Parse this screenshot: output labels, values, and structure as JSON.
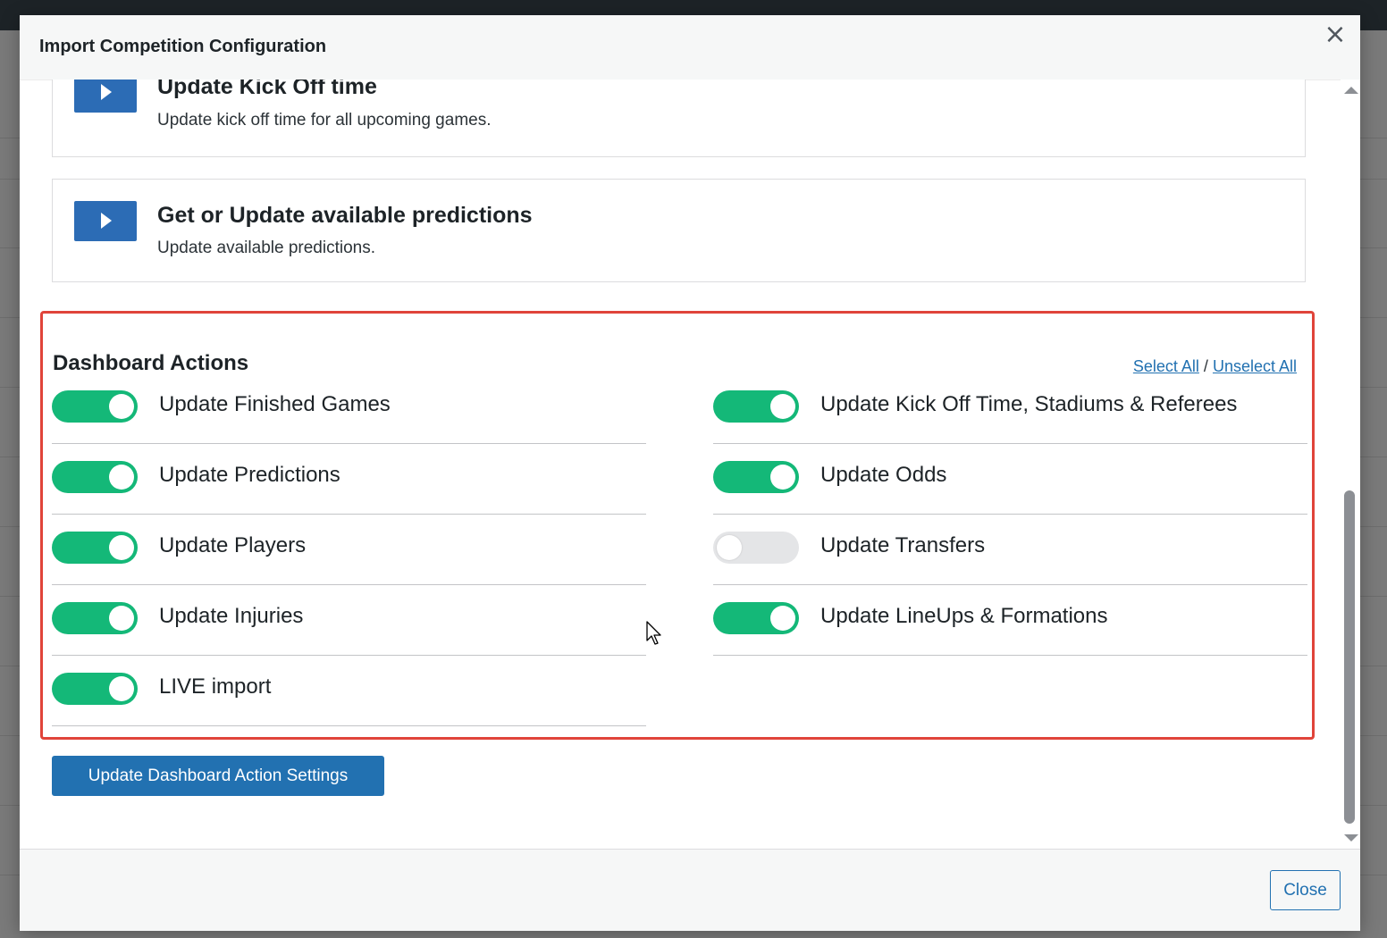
{
  "modal": {
    "title": "Import Competition Configuration",
    "close_icon": "×"
  },
  "actions": [
    {
      "title": "Update Kick Off time",
      "description": "Update kick off time for all upcoming games."
    },
    {
      "title": "Get or Update available predictions",
      "description": "Update available predictions."
    }
  ],
  "dashboard": {
    "title": "Dashboard Actions",
    "select_all": "Select All",
    "separator": "/",
    "unselect_all": "Unselect All",
    "toggles": [
      {
        "label": "Update Finished Games",
        "on": true
      },
      {
        "label": "Update Kick Off Time, Stadiums & Referees",
        "on": true
      },
      {
        "label": "Update Predictions",
        "on": true
      },
      {
        "label": "Update Odds",
        "on": true
      },
      {
        "label": "Update Players",
        "on": true
      },
      {
        "label": "Update Transfers",
        "on": false
      },
      {
        "label": "Update Injuries",
        "on": true
      },
      {
        "label": "Update LineUps & Formations",
        "on": true
      },
      {
        "label": "LIVE import",
        "on": true
      }
    ],
    "submit_label": "Update Dashboard Action Settings"
  },
  "footer": {
    "close_label": "Close"
  },
  "colors": {
    "toggle_on": "#14b878",
    "toggle_off": "#e4e5e7",
    "primary": "#2271b1",
    "highlight_border": "#e0443a"
  }
}
